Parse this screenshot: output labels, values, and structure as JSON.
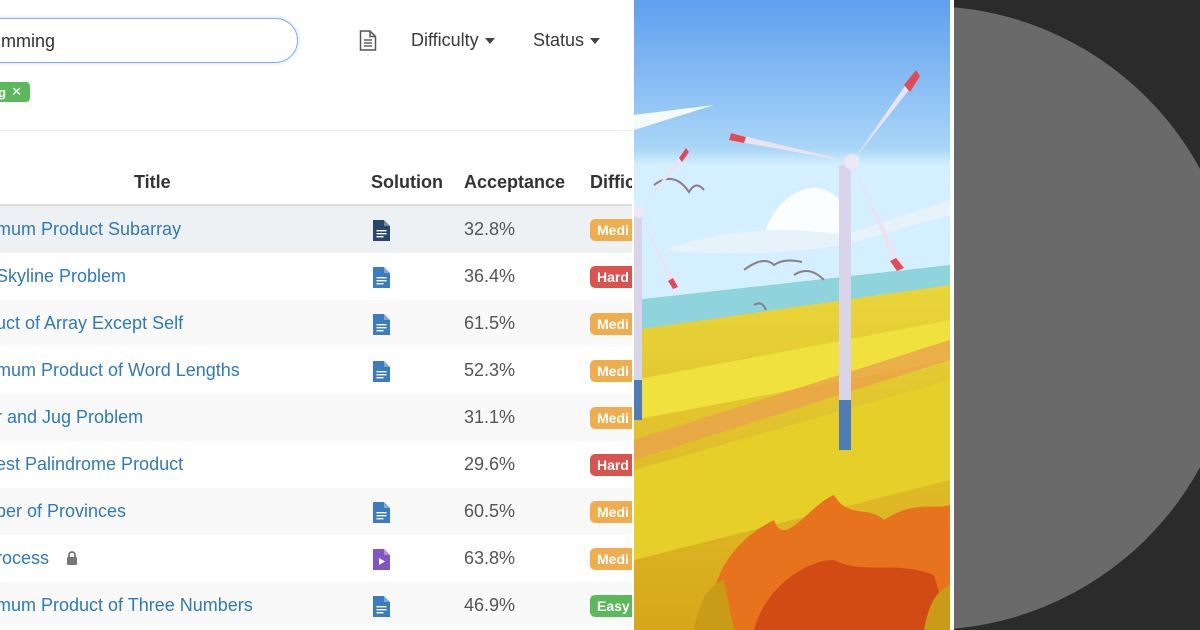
{
  "search": {
    "value": "mming"
  },
  "toolbar": {
    "list_icon": "document-icon",
    "difficulty_label": "Difficulty",
    "status_label": "Status"
  },
  "tags": [
    {
      "label": "g",
      "remove_icon": "close-icon"
    }
  ],
  "table": {
    "headers": {
      "title": "Title",
      "solution": "Solution",
      "acceptance": "Acceptance",
      "difficulty": "Diffic"
    },
    "rows": [
      {
        "title": "mum Product Subarray",
        "solution": "article-icon",
        "acceptance": "32.8%",
        "difficulty": "Medi",
        "diff_color": "#f0ad4e"
      },
      {
        "title": "Skyline Problem",
        "solution": "article-icon",
        "acceptance": "36.4%",
        "difficulty": "Hard",
        "diff_color": "#d9534f"
      },
      {
        "title": "uct of Array Except Self",
        "solution": "article-icon",
        "acceptance": "61.5%",
        "difficulty": "Medi",
        "diff_color": "#f0ad4e"
      },
      {
        "title": "mum Product of Word Lengths",
        "solution": "article-icon",
        "acceptance": "52.3%",
        "difficulty": "Medi",
        "diff_color": "#f0ad4e"
      },
      {
        "title": "r and Jug Problem",
        "solution": "",
        "acceptance": "31.1%",
        "difficulty": "Medi",
        "diff_color": "#f0ad4e"
      },
      {
        "title": "est Palindrome Product",
        "solution": "",
        "acceptance": "29.6%",
        "difficulty": "Hard",
        "diff_color": "#d9534f"
      },
      {
        "title": "ber of Provinces",
        "solution": "article-icon",
        "acceptance": "60.5%",
        "difficulty": "Medi",
        "diff_color": "#f0ad4e"
      },
      {
        "title": "rocess",
        "locked": true,
        "solution": "video-icon",
        "acceptance": "63.8%",
        "difficulty": "Medi",
        "diff_color": "#f0ad4e"
      },
      {
        "title": "mum Product of Three Numbers",
        "solution": "article-icon",
        "acceptance": "46.9%",
        "difficulty": "Easy",
        "diff_color": "#5cb85c"
      }
    ]
  },
  "colors": {
    "link": "#2f7ab8",
    "article_icon": "#3a7bc1",
    "video_icon": "#7e57c2",
    "tag": "#5cb85c"
  },
  "illustration": {
    "subject": "wind turbines over yellow field"
  },
  "right_panel": {
    "subject": "grey circle on dark background"
  }
}
